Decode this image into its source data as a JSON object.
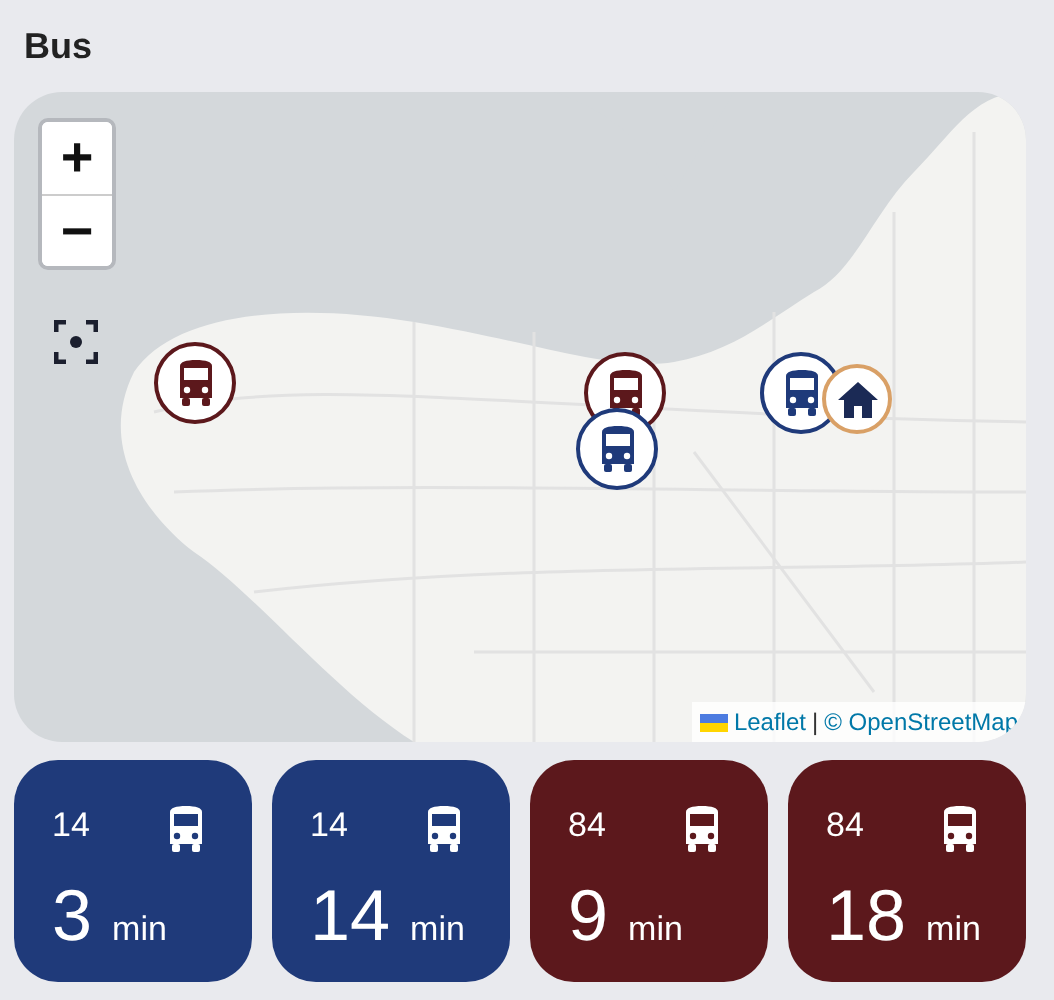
{
  "title": "Bus",
  "map": {
    "zoom_in": "+",
    "zoom_out": "−",
    "attribution_link": "Leaflet",
    "attribution_sep": "|",
    "attribution_text": "© OpenStreetMap",
    "markers": [
      {
        "kind": "bus",
        "color": "#5c181c"
      },
      {
        "kind": "bus",
        "color": "#5c181c"
      },
      {
        "kind": "bus",
        "color": "#1f3a7a"
      },
      {
        "kind": "bus",
        "color": "#1f3a7a"
      },
      {
        "kind": "home",
        "color": "#d9a066"
      }
    ]
  },
  "arrivals": [
    {
      "route": "14",
      "minutes": "3",
      "unit": "min",
      "color": "#1f3a7a"
    },
    {
      "route": "14",
      "minutes": "14",
      "unit": "min",
      "color": "#1f3a7a"
    },
    {
      "route": "84",
      "minutes": "9",
      "unit": "min",
      "color": "#5c181c"
    },
    {
      "route": "84",
      "minutes": "18",
      "unit": "min",
      "color": "#5c181c"
    }
  ]
}
